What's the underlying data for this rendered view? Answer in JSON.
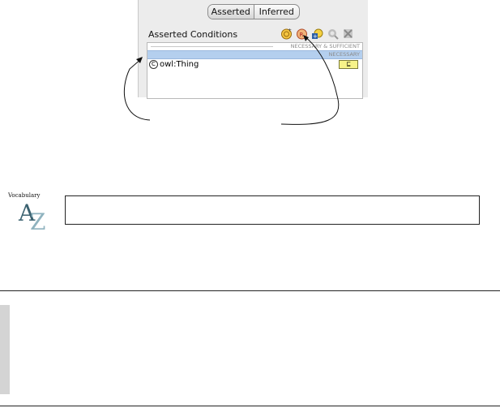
{
  "tabs": [
    {
      "label": "Asserted",
      "active": true
    },
    {
      "label": "Inferred",
      "active": false
    }
  ],
  "conditions": {
    "title": "Asserted Conditions",
    "toolbar": [
      "add-named-class-icon",
      "restriction-icon",
      "add-expression-icon",
      "search-icon",
      "delete-icon"
    ],
    "sections": {
      "necessary_sufficient": "NECESSARY & SUFFICIENT",
      "necessary": "NECESSARY"
    },
    "rows": [
      {
        "icon": "C",
        "label": "owl:Thing",
        "badge": "⊑"
      }
    ]
  },
  "vocabulary": {
    "label": "Vocabulary",
    "letter_a": "A",
    "letter_z": "Z"
  },
  "colors": {
    "selection": "#b4cfee",
    "badge": "#f7f389",
    "panel": "#ececec"
  }
}
